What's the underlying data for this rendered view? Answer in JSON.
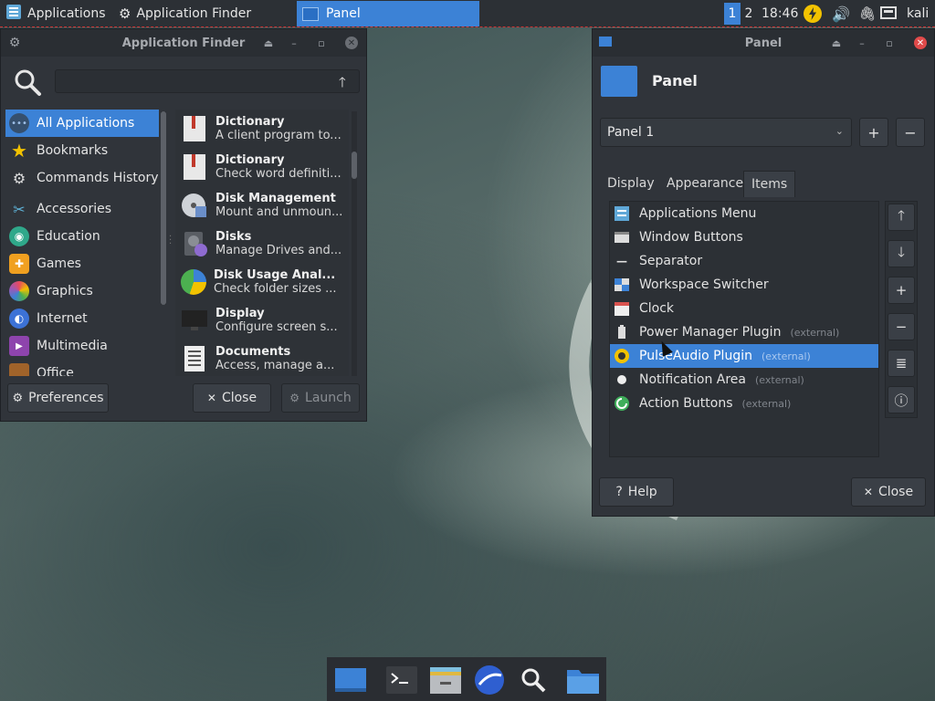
{
  "top_panel": {
    "applications_label": "Applications",
    "app_finder_label": "Application Finder",
    "task_label": "Panel",
    "workspaces": [
      "1",
      "2"
    ],
    "clock": "18:46",
    "user": "kali"
  },
  "app_finder": {
    "title": "Application Finder",
    "search_placeholder": "",
    "categories": [
      {
        "label": "All Applications",
        "selected": true
      },
      {
        "label": "Bookmarks"
      },
      {
        "label": "Commands History"
      },
      {
        "label": "Accessories"
      },
      {
        "label": "Education"
      },
      {
        "label": "Games"
      },
      {
        "label": "Graphics"
      },
      {
        "label": "Internet"
      },
      {
        "label": "Multimedia"
      },
      {
        "label": "Office"
      }
    ],
    "apps": [
      {
        "name": "Dictionary",
        "desc": "A client program to..."
      },
      {
        "name": "Dictionary",
        "desc": "Check word definiti..."
      },
      {
        "name": "Disk Management",
        "desc": "Mount and unmoun..."
      },
      {
        "name": "Disks",
        "desc": "Manage Drives and..."
      },
      {
        "name": "Disk Usage Anal...",
        "desc": "Check folder sizes ..."
      },
      {
        "name": "Display",
        "desc": "Configure screen s..."
      },
      {
        "name": "Documents",
        "desc": "Access, manage a..."
      }
    ],
    "preferences_label": "Preferences",
    "close_label": "Close",
    "launch_label": "Launch"
  },
  "panel_prefs": {
    "title": "Panel",
    "heading": "Panel",
    "selected_panel": "Panel 1",
    "tabs": [
      "Display",
      "Appearance",
      "Items"
    ],
    "active_tab": "Items",
    "items": [
      {
        "label": "Applications Menu",
        "ext": ""
      },
      {
        "label": "Window Buttons",
        "ext": ""
      },
      {
        "label": "Separator",
        "ext": ""
      },
      {
        "label": "Workspace Switcher",
        "ext": ""
      },
      {
        "label": "Clock",
        "ext": ""
      },
      {
        "label": "Power Manager Plugin",
        "ext": "(external)"
      },
      {
        "label": "PulseAudio Plugin",
        "ext": "(external)",
        "selected": true
      },
      {
        "label": "Notification Area",
        "ext": "(external)"
      },
      {
        "label": "Action Buttons",
        "ext": "(external)"
      }
    ],
    "help_label": "Help",
    "close_label": "Close"
  },
  "colors": {
    "accent": "#3c82d6",
    "panel_bg": "#2c3035",
    "window_bg": "#30343a"
  }
}
